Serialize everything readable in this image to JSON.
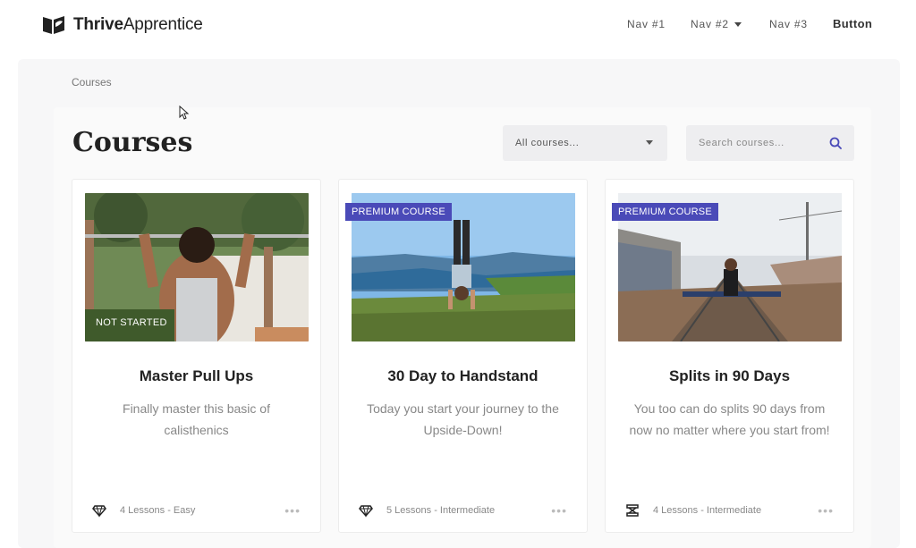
{
  "brand": {
    "bold": "Thrive",
    "rest": "Apprentice"
  },
  "nav": {
    "item1": "Nav #1",
    "item2": "Nav #2",
    "item3": "Nav #3",
    "button": "Button"
  },
  "breadcrumb": "Courses",
  "page_title": "Courses",
  "filter": {
    "selected": "All courses..."
  },
  "search": {
    "placeholder": "Search courses..."
  },
  "courses": [
    {
      "title": "Master Pull Ups",
      "description": "Finally master this basic of calisthenics",
      "badge": "",
      "status": "NOT STARTED",
      "meta": "4 Lessons - Easy",
      "icon": "diamond-icon"
    },
    {
      "title": "30 Day to Handstand",
      "description": "Today you start your journey to the Upside-Down!",
      "badge": "PREMIUM COURSE",
      "status": "",
      "meta": "5 Lessons - Intermediate",
      "icon": "diamond-icon"
    },
    {
      "title": "Splits in 90 Days",
      "description": "You too can do splits 90 days from now no matter where you start from!",
      "badge": "PREMIUM COURSE",
      "status": "",
      "meta": "4 Lessons - Intermediate",
      "icon": "hourglass-icon"
    }
  ],
  "more_glyph": "•••",
  "colors": {
    "badge": "#4a4ab8",
    "accent": "#4a4ab8"
  }
}
